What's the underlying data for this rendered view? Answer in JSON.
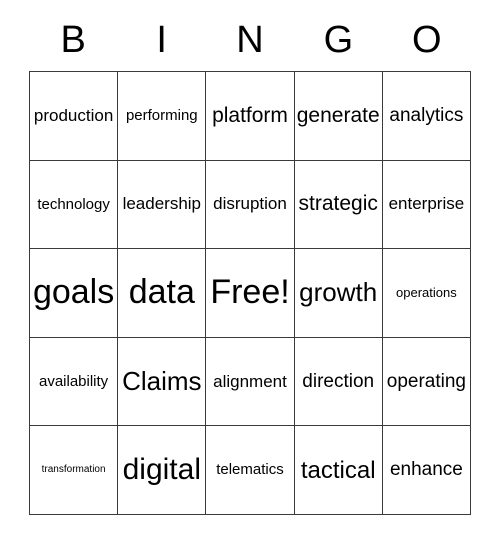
{
  "card": {
    "header_letters": [
      "B",
      "I",
      "N",
      "G",
      "O"
    ],
    "columns": 5,
    "rows": 5,
    "background_color": "#ffffff",
    "border_color": "#3a3a3a",
    "text_color": "#000000",
    "free_space_label": "Free!",
    "free_space_position": {
      "row": 3,
      "column": 3
    },
    "cells": [
      [
        {
          "label": "production",
          "size": "m"
        },
        {
          "label": "performing",
          "size": "sm"
        },
        {
          "label": "platform",
          "size": "l"
        },
        {
          "label": "generate",
          "size": "l"
        },
        {
          "label": "analytics",
          "size": "ml"
        }
      ],
      [
        {
          "label": "technology",
          "size": "sm"
        },
        {
          "label": "leadership",
          "size": "m"
        },
        {
          "label": "disruption",
          "size": "m"
        },
        {
          "label": "strategic",
          "size": "l"
        },
        {
          "label": "enterprise",
          "size": "m"
        }
      ],
      [
        {
          "label": "goals",
          "size": "max"
        },
        {
          "label": "data",
          "size": "max"
        },
        {
          "label": "Free!",
          "size": "max"
        },
        {
          "label": "growth",
          "size": "xxl"
        },
        {
          "label": "operations",
          "size": "s"
        }
      ],
      [
        {
          "label": "availability",
          "size": "sm"
        },
        {
          "label": "Claims",
          "size": "xxl"
        },
        {
          "label": "alignment",
          "size": "m"
        },
        {
          "label": "direction",
          "size": "ml"
        },
        {
          "label": "operating",
          "size": "ml"
        }
      ],
      [
        {
          "label": "transformation",
          "size": "xs"
        },
        {
          "label": "digital",
          "size": "huge"
        },
        {
          "label": "telematics",
          "size": "sm"
        },
        {
          "label": "tactical",
          "size": "xl"
        },
        {
          "label": "enhance",
          "size": "ml"
        }
      ]
    ]
  }
}
